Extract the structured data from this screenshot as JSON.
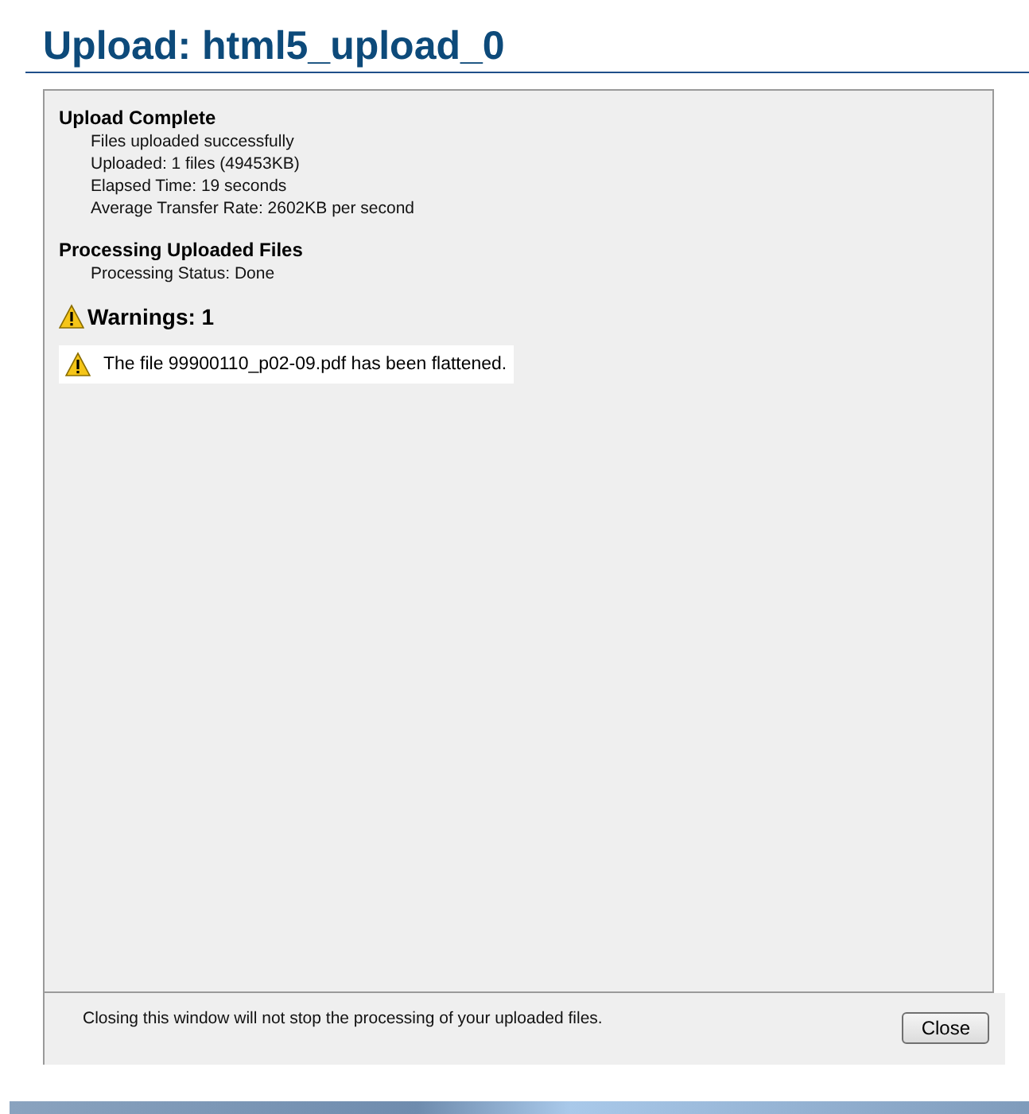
{
  "title": "Upload: html5_upload_0",
  "sections": [
    {
      "heading": "Upload Complete",
      "lines": [
        "Files uploaded successfully",
        "Uploaded: 1 files (49453KB)",
        "Elapsed Time: 19 seconds",
        "Average Transfer Rate: 2602KB per second"
      ]
    },
    {
      "heading": "Processing Uploaded Files",
      "lines": [
        "Processing Status: Done"
      ]
    }
  ],
  "warnings": {
    "heading": "Warnings: 1",
    "items": [
      "The file 99900110_p02-09.pdf has been flattened."
    ]
  },
  "footer": {
    "note": "Closing this window will not stop the processing of your uploaded files.",
    "button": "Close"
  }
}
